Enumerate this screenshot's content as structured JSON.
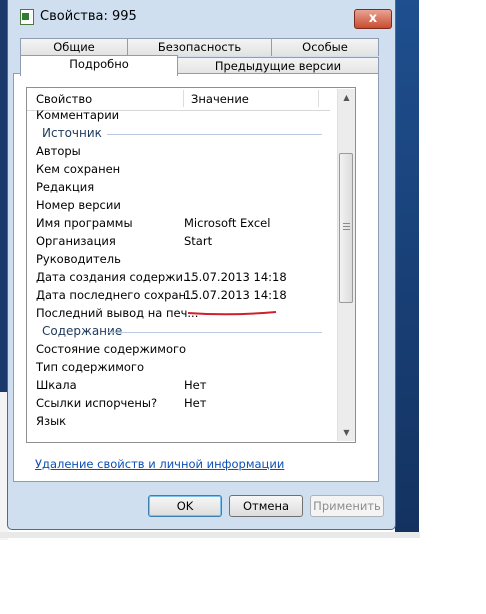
{
  "window": {
    "title": "Свойства: 995",
    "close_glyph": "x"
  },
  "tabs": {
    "row1": [
      "Общие",
      "Безопасность",
      "Особые"
    ],
    "row2": [
      "Подробно",
      "Предыдущие версии"
    ],
    "active": "Подробно"
  },
  "list": {
    "col_property": "Свойство",
    "col_value": "Значение",
    "rows": [
      {
        "type": "item",
        "property": "Комментарии",
        "value": ""
      },
      {
        "type": "group",
        "property": "Источник"
      },
      {
        "type": "item",
        "property": "Авторы",
        "value": ""
      },
      {
        "type": "item",
        "property": "Кем сохранен",
        "value": ""
      },
      {
        "type": "item",
        "property": "Редакция",
        "value": ""
      },
      {
        "type": "item",
        "property": "Номер версии",
        "value": ""
      },
      {
        "type": "item",
        "property": "Имя программы",
        "value": "Microsoft Excel"
      },
      {
        "type": "item",
        "property": "Организация",
        "value": "Start"
      },
      {
        "type": "item",
        "property": "Руководитель",
        "value": ""
      },
      {
        "type": "item",
        "property": "Дата создания содержи...",
        "value": "15.07.2013 14:18"
      },
      {
        "type": "item",
        "property": "Дата последнего сохран...",
        "value": "15.07.2013 14:18"
      },
      {
        "type": "item",
        "property": "Последний вывод на печ...",
        "value": ""
      },
      {
        "type": "group",
        "property": "Содержание"
      },
      {
        "type": "item",
        "property": "Состояние содержимого",
        "value": ""
      },
      {
        "type": "item",
        "property": "Тип содержимого",
        "value": ""
      },
      {
        "type": "item",
        "property": "Шкала",
        "value": "Нет"
      },
      {
        "type": "item",
        "property": "Ссылки испорчены?",
        "value": "Нет"
      },
      {
        "type": "item",
        "property": "Язык",
        "value": ""
      }
    ]
  },
  "remove_link": "Удаление свойств и личной информации",
  "buttons": {
    "ok": "OK",
    "cancel": "Отмена",
    "apply": "Применить"
  },
  "colors": {
    "accent_underline": "#d0202a",
    "link": "#0b4fb5",
    "group_text": "#1e395b"
  }
}
